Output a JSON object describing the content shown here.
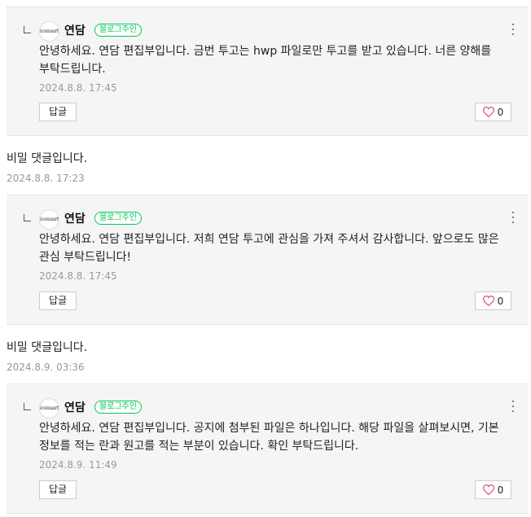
{
  "replies": [
    {
      "avatar_text": "iconuart",
      "author": "연담",
      "badge": "블로그주인",
      "text": "안녕하세요. 연담 편집부입니다. 금번 투고는 hwp 파일로만 투고를 받고 있습니다. 너른 양해를 부탁드립니다.",
      "date": "2024.8.8. 17:45",
      "reply_label": "답글",
      "like_count": "0"
    },
    {
      "avatar_text": "iconuart",
      "author": "연담",
      "badge": "블로그주인",
      "text": "안녕하세요. 연담 편집부입니다. 저희 연담 투고에 관심을 가져 주셔서 감사합니다. 앞으로도 많은 관심 부탁드립니다!",
      "date": "2024.8.8. 17:45",
      "reply_label": "답글",
      "like_count": "0"
    },
    {
      "avatar_text": "iconuart",
      "author": "연담",
      "badge": "블로그주인",
      "text": "안녕하세요. 연담 편집부입니다. 공지에 첨부된 파일은 하나입니다. 해당 파일을 살펴보시면, 기본 정보를 적는 란과 원고를 적는 부분이 있습니다. 확인 부탁드립니다.",
      "date": "2024.8.9. 11:49",
      "reply_label": "답글",
      "like_count": "0"
    }
  ],
  "comments": [
    {
      "text": "비밀 댓글입니다.",
      "date": "2024.8.8. 17:23"
    },
    {
      "text": "비밀 댓글입니다.",
      "date": "2024.8.9. 03:36"
    }
  ]
}
